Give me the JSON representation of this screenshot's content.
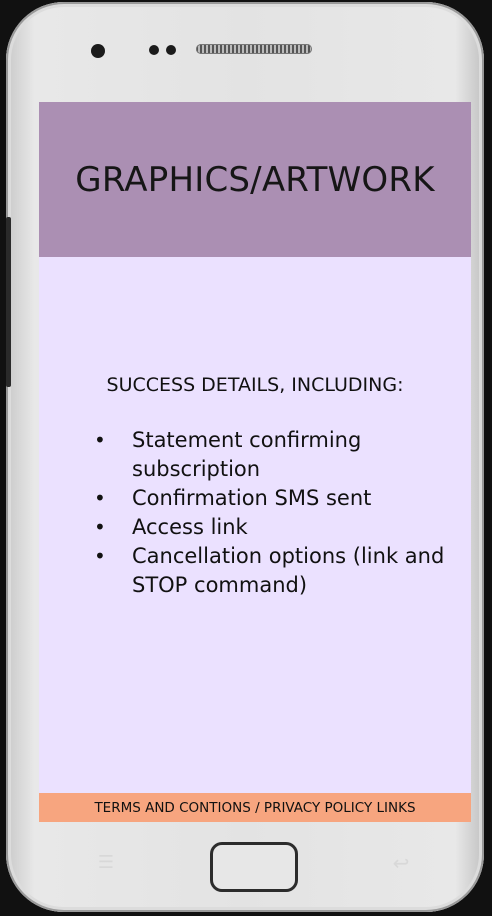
{
  "device": {
    "icons": [
      "camera-icon",
      "proximity-sensor-icon",
      "speaker-grille-icon",
      "menu-key-icon",
      "back-key-icon"
    ]
  },
  "screen": {
    "header": {
      "title": "GRAPHICS/ARTWORK",
      "background_color": "#ab8fb3"
    },
    "content": {
      "heading": "SUCCESS DETAILS, INCLUDING:",
      "bullet_char": "•",
      "items": [
        "Statement confirming subscription",
        "Confirmation SMS sent",
        "Access link",
        "Cancellation options (link and STOP command)"
      ],
      "background_color": "#ebe1ff"
    },
    "footer": {
      "text": "TERMS AND CONTIONS / PRIVACY POLICY LINKS",
      "background_color": "#f7a57f"
    }
  }
}
